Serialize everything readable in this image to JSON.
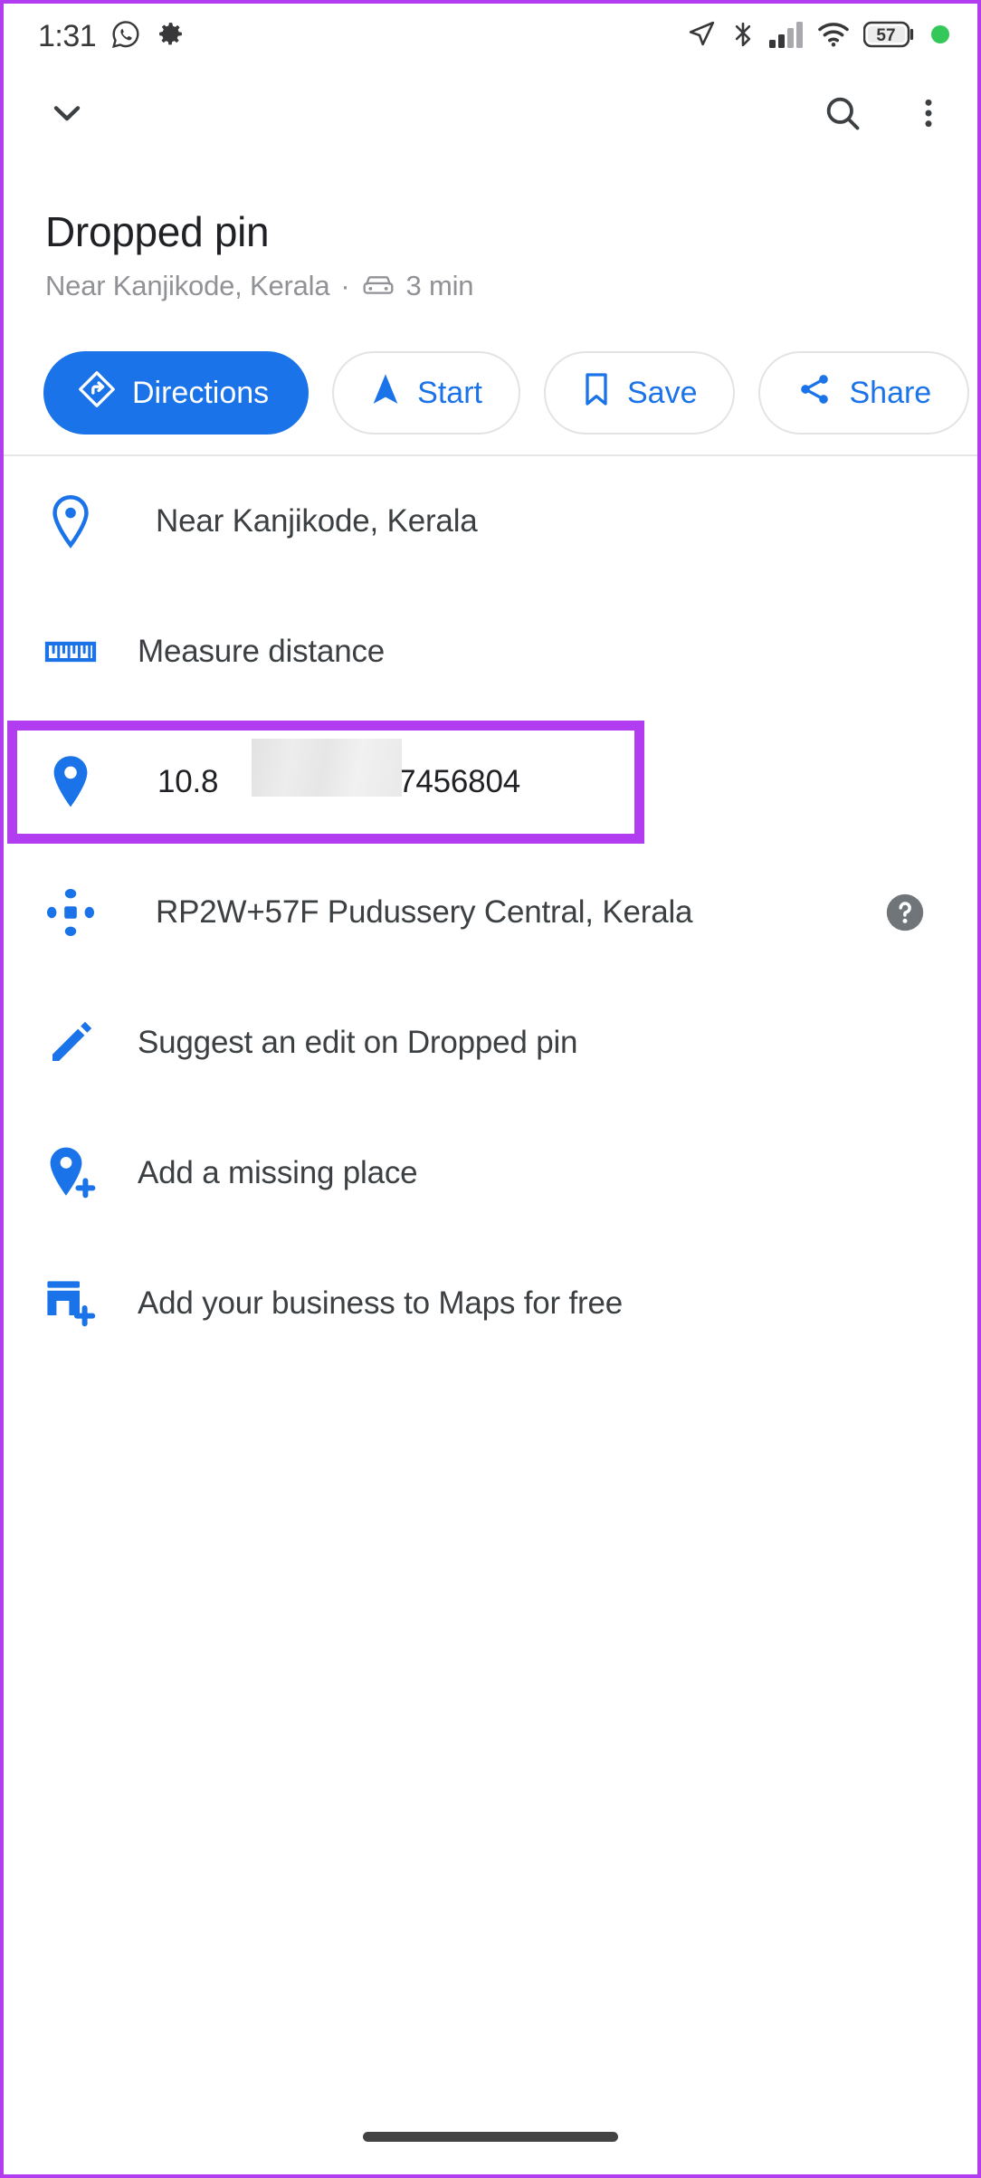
{
  "status_bar": {
    "time": "1:31",
    "left_icons": [
      "whatsapp-icon",
      "gear-icon"
    ],
    "right_icons": [
      "location-arrow-icon",
      "bluetooth-icon",
      "signal-bars-icon",
      "wifi-icon",
      "battery-icon",
      "recording-dot-icon"
    ],
    "battery_level": "57",
    "dot_color": "#34c759"
  },
  "app_bar": {
    "collapse_label": "chevron-down-icon",
    "search_label": "search-icon",
    "overflow_label": "more-vert-icon"
  },
  "place": {
    "title": "Dropped pin",
    "subtitle_location": "Near Kanjikode, Kerala",
    "subtitle_separator": "·",
    "drive_time": "3 min"
  },
  "actions": [
    {
      "label": "Directions",
      "icon": "directions-icon",
      "style": "primary"
    },
    {
      "label": "Start",
      "icon": "navigation-arrow-icon",
      "style": "outline"
    },
    {
      "label": "Save",
      "icon": "bookmark-icon",
      "style": "outline"
    },
    {
      "label": "Share",
      "icon": "share-icon",
      "style": "outline"
    }
  ],
  "details": [
    {
      "label": "Near Kanjikode, Kerala",
      "icon": "location-pin-outline-icon"
    },
    {
      "label": "Measure distance",
      "icon": "ruler-icon"
    },
    {
      "label": "RP2W+57F Pudussery Central, Kerala",
      "icon": "plus-code-icon",
      "trailing": "help-circle-icon"
    },
    {
      "label": "Suggest an edit on Dropped pin",
      "icon": "pencil-icon"
    },
    {
      "label": "Add a missing place",
      "icon": "add-location-icon"
    },
    {
      "label": "Add your business to Maps for free",
      "icon": "add-business-icon"
    }
  ],
  "coordinates": {
    "prefix": "10.8",
    "suffix": "6.7456804",
    "icon": "location-pin-filled-icon",
    "redacted": true,
    "highlight_color": "#b23cf0"
  },
  "colors": {
    "accent_blue": "#1a73e8",
    "highlight_purple": "#b23cf0",
    "text_primary": "#202124",
    "text_secondary": "#919296"
  }
}
